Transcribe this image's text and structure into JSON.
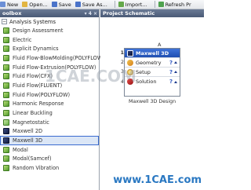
{
  "toolbar": {
    "items": [
      {
        "label": "New",
        "icon": "new-icon",
        "color": "#6b8fd6"
      },
      {
        "label": "Open...",
        "icon": "open-icon",
        "color": "#e2b542"
      },
      {
        "label": "Save",
        "icon": "save-icon",
        "color": "#4a73c9"
      },
      {
        "label": "Save As...",
        "icon": "save-as-icon",
        "color": "#4a73c9"
      },
      {
        "label": "Import...",
        "icon": "import-icon",
        "color": "#64a84a"
      },
      {
        "label": "Refresh Pr",
        "icon": "refresh-icon",
        "color": "#4fa24f"
      }
    ]
  },
  "toolbox": {
    "title": "oolbox",
    "pin": "▾ 4 ×",
    "group_label": "Analysis Systems",
    "group_expander": "−",
    "systems": [
      {
        "label": "Design Assessment",
        "type": "green"
      },
      {
        "label": "Electric",
        "type": "green"
      },
      {
        "label": "Explicit Dynamics",
        "type": "green"
      },
      {
        "label": "Fluid Flow-BlowMolding(POLYFLOW)",
        "type": "green"
      },
      {
        "label": "Fluid Flow-Extrusion(POLYFLOW)",
        "type": "green"
      },
      {
        "label": "Fluid Flow(CFX)",
        "type": "green"
      },
      {
        "label": "Fluid Flow(FLUENT)",
        "type": "green"
      },
      {
        "label": "Fluid Flow(POLYFLOW)",
        "type": "green"
      },
      {
        "label": "Harmonic Response",
        "type": "green"
      },
      {
        "label": "Linear Buckling",
        "type": "green"
      },
      {
        "label": "Magnetostatic",
        "type": "magneto"
      },
      {
        "label": "Maxwell 2D",
        "type": "maxwell"
      },
      {
        "label": "Maxwell 3D",
        "type": "maxwell",
        "selected": true
      },
      {
        "label": "Modal",
        "type": "green"
      },
      {
        "label": "Modal(Samcef)",
        "type": "green"
      },
      {
        "label": "Random Vibration",
        "type": "green"
      }
    ]
  },
  "schematic": {
    "title": "Project Schematic",
    "column_letter": "A",
    "block": {
      "rows": [
        {
          "num": "1",
          "label": "Maxwell 3D",
          "icon": "maxwell-icon",
          "status": "",
          "title": true
        },
        {
          "num": "2",
          "label": "Geometry",
          "icon": "geometry-icon",
          "status": "?"
        },
        {
          "num": "3",
          "label": "Setup",
          "icon": "setup-icon",
          "status": "?"
        },
        {
          "num": "4",
          "label": "Solution",
          "icon": "solution-icon",
          "status": "?"
        }
      ],
      "caption": "Maxwell 3D Design"
    }
  },
  "watermarks": {
    "middle": "1CAE.COM",
    "bottom": "www.1CAE.com"
  }
}
